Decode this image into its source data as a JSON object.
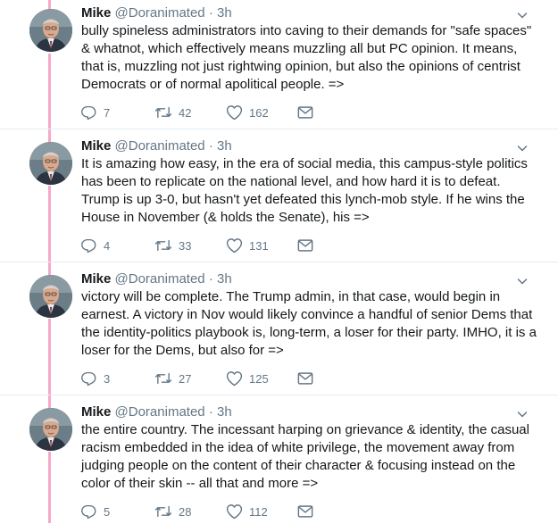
{
  "tweets": [
    {
      "name": "Mike",
      "handle": "@Doranimated",
      "sep": "·",
      "time": "3h",
      "text": "bully spineless administrators into caving to their demands for \"safe spaces\" & whatnot, which effectively means muzzling all but PC opinion. It means, that is, muzzling not just rightwing opinion, but also the opinions of centrist Democrats or of normal apolitical people. =>",
      "replies": "7",
      "retweets": "42",
      "likes": "162"
    },
    {
      "name": "Mike",
      "handle": "@Doranimated",
      "sep": "·",
      "time": "3h",
      "text": "It is amazing how easy, in the era of social media, this campus-style politics has been to replicate on the national level, and how hard it is to defeat. Trump is up 3-0, but hasn't yet defeated this lynch-mob style. If he wins the House in November (& holds the Senate), his =>",
      "replies": "4",
      "retweets": "33",
      "likes": "131"
    },
    {
      "name": "Mike",
      "handle": "@Doranimated",
      "sep": "·",
      "time": "3h",
      "text": "victory will be complete. The Trump admin, in that case, would begin in earnest. A victory in Nov would likely convince a handful of senior Dems that the identity-politics playbook is, long-term, a loser for their party. IMHO, it is a loser for the Dems, but also for =>",
      "replies": "3",
      "retweets": "27",
      "likes": "125"
    },
    {
      "name": "Mike",
      "handle": "@Doranimated",
      "sep": "·",
      "time": "3h",
      "text": "the entire country. The incessant harping on grievance & identity, the casual racism embedded in the idea of white privilege, the movement away from judging people on the content of their character & focusing instead on the color of their skin -- all that and more =>",
      "replies": "5",
      "retweets": "28",
      "likes": "112"
    }
  ],
  "icons": {
    "reply": "reply-icon",
    "retweet": "retweet-icon",
    "like": "heart-icon",
    "dm": "envelope-icon",
    "more": "chevron-down-icon"
  },
  "colors": {
    "thread_line": "#f4a9c8",
    "icon_gray": "#657786",
    "text": "#14171a",
    "divider": "#e6ecf0"
  }
}
